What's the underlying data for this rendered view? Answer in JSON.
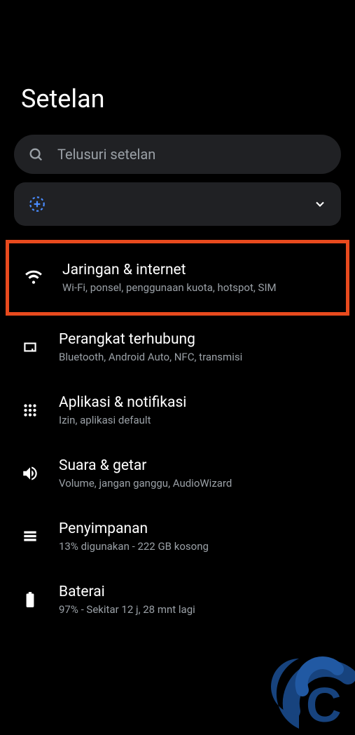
{
  "header": {
    "title": "Setelan"
  },
  "search": {
    "placeholder": "Telusuri setelan"
  },
  "items": [
    {
      "title": "Jaringan & internet",
      "subtitle": "Wi-Fi, ponsel, penggunaan kuota, hotspot, SIM",
      "highlighted": true
    },
    {
      "title": "Perangkat terhubung",
      "subtitle": "Bluetooth, Android Auto, NFC, transmisi",
      "highlighted": false
    },
    {
      "title": "Aplikasi & notifikasi",
      "subtitle": "Izin, aplikasi default",
      "highlighted": false
    },
    {
      "title": "Suara & getar",
      "subtitle": "Volume, jangan ganggu, AudioWizard",
      "highlighted": false
    },
    {
      "title": "Penyimpanan",
      "subtitle": "13% digunakan - 222 GB kosong",
      "highlighted": false
    },
    {
      "title": "Baterai",
      "subtitle": "97% - Sekitar 12 j, 28 mnt lagi",
      "highlighted": false
    }
  ]
}
